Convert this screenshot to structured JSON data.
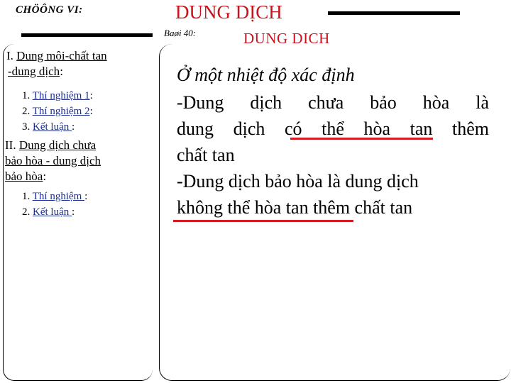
{
  "header": {
    "chapter": "CHÖÔNG VI:",
    "main_title": "DUNG DỊCH",
    "lesson_label": "Baøi 40:",
    "lesson_title": "DUNG DỊCH"
  },
  "outline": {
    "section1": {
      "roman": "I.",
      "title_a": "Dung môi-chất tan",
      "title_b": "-dung dịch",
      "colon": ":"
    },
    "section1_items": [
      {
        "num": "1.",
        "label": "Thí nghiệm 1",
        "suffix": ":"
      },
      {
        "num": "2.",
        "label": "Thí nghiệm 2",
        "suffix": ":"
      },
      {
        "num": "3.",
        "label": "Kết luận ",
        "suffix": ":"
      }
    ],
    "section2": {
      "roman": "II.",
      "title_a": "Dung dịch chưa",
      "title_b": "bảo hòa - dung dịch",
      "title_c": "bảo hòa",
      "colon": ":"
    },
    "section2_items": [
      {
        "num": "1.",
        "label": "Thí nghiệm ",
        "suffix": ":"
      },
      {
        "num": "2.",
        "label": "Kết luận ",
        "suffix": ":"
      }
    ]
  },
  "content": {
    "intro": "Ở một nhiệt độ xác định",
    "line1": "-Dung dịch chưa bảo hòa là",
    "line2": "dung dịch có thể hòa tan thêm",
    "line3": "chất tan",
    "line4": "-Dung dịch bảo hòa là dung dịch",
    "line5": "không thể hòa tan thêm chất tan"
  },
  "colors": {
    "title_red": "#c8141e",
    "underline_red": "#d41a23",
    "link_blue": "#1d2e8c"
  }
}
